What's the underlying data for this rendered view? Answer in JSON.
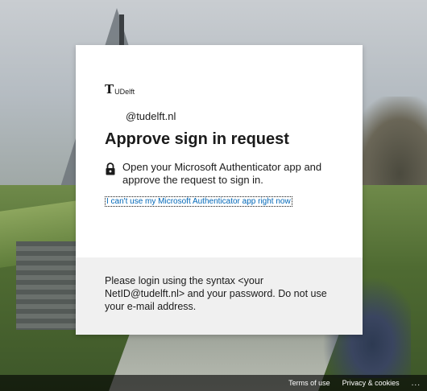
{
  "logo": {
    "mark": "T",
    "text": "UDelft"
  },
  "signin": {
    "account": "@tudelft.nl",
    "title": "Approve sign in request",
    "instruction": "Open your Microsoft Authenticator app and approve the request to sign in.",
    "alt_link": "I can't use my Microsoft Authenticator app right now"
  },
  "footer": {
    "text": "Please login using the syntax <your NetID@tudelft.nl> and your password. Do not use your e-mail address."
  },
  "bottom_bar": {
    "terms": "Terms of use",
    "privacy": "Privacy & cookies",
    "more": "..."
  },
  "icons": {
    "instruction": "lock-icon"
  },
  "colors": {
    "link": "#0067b8",
    "card": "#ffffff",
    "footer_bg": "#f0f0f0"
  }
}
